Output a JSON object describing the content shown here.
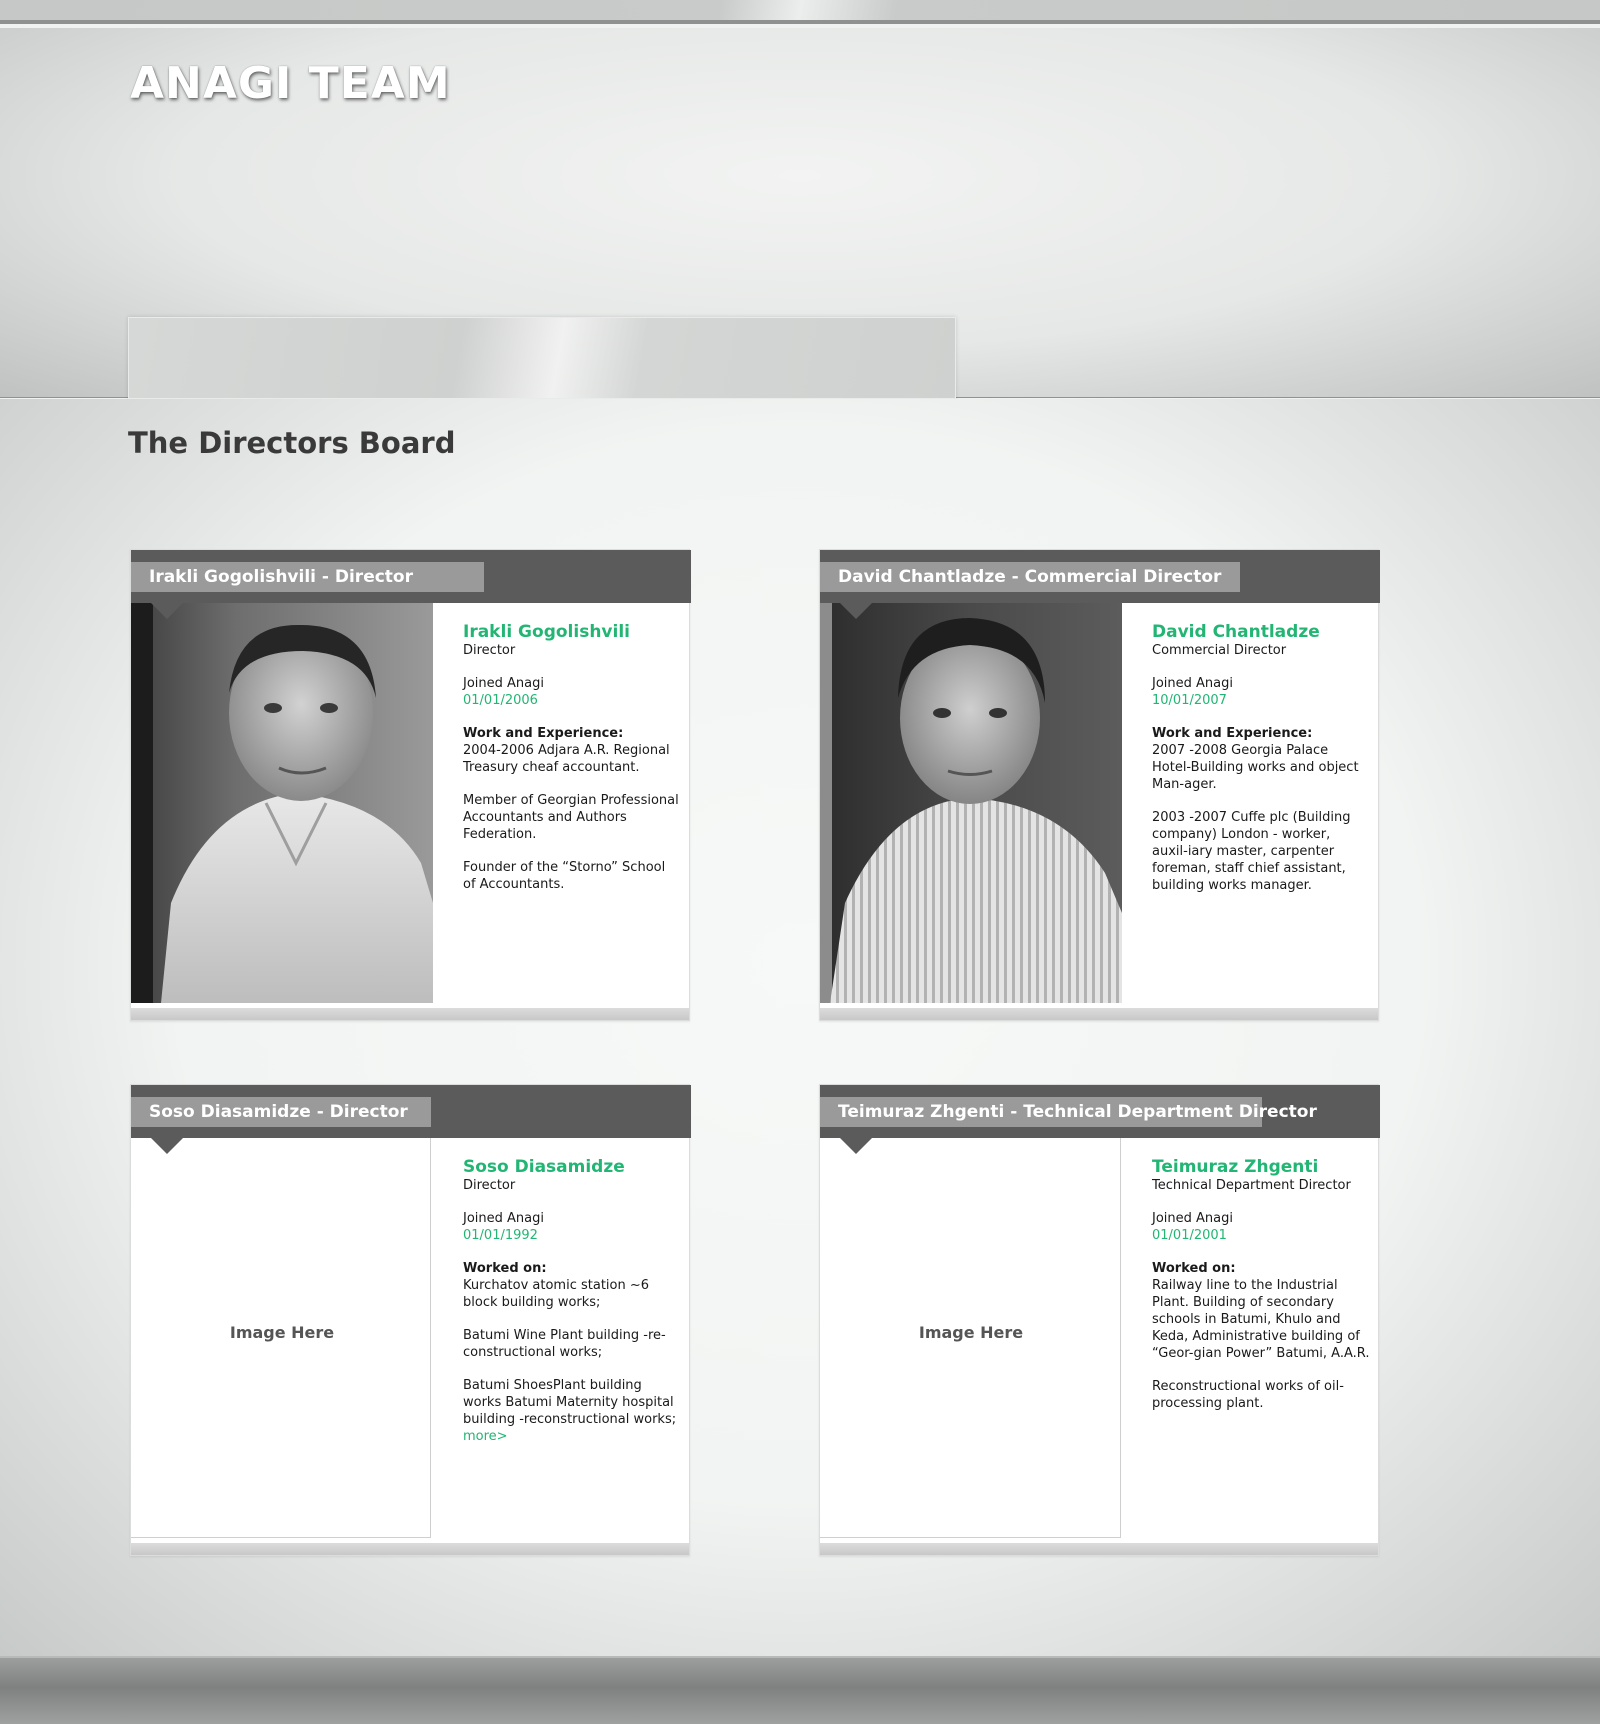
{
  "header": {
    "title": "ANAGI TEAM"
  },
  "section": {
    "title": "The Directors Board"
  },
  "cards": [
    {
      "header_label": "Irakli Gogolishvili - Director",
      "name": "Irakli Gogolishvili",
      "role": "Director",
      "joined_label": "Joined Anagi",
      "joined_date": "01/01/2006",
      "section_heading": "Work and Experience:",
      "paragraphs": [
        "2004-2006 Adjara A.R. Regional Treasury cheaf accountant.",
        "Member of Georgian Professional Accountants and Authors Federation.",
        "Founder of the “Storno” School of Accountants."
      ]
    },
    {
      "header_label": "David Chantladze - Commercial Director",
      "name": "David Chantladze",
      "role": "Commercial Director",
      "joined_label": "Joined Anagi",
      "joined_date": "10/01/2007",
      "section_heading": "Work and Experience:",
      "paragraphs": [
        "2007 -2008 Georgia Palace Hotel-Building works and object Man-ager.",
        "2003 -2007 Cuffe plc (Building company) London - worker, auxil-iary master, carpenter foreman, staff chief assistant, building works manager."
      ]
    },
    {
      "header_label": "Soso Diasamidze - Director",
      "name": "Soso Diasamidze",
      "role": "Director",
      "joined_label": "Joined Anagi",
      "joined_date": "01/01/1992",
      "section_heading": "Worked on:",
      "image_placeholder": "Image Here",
      "paragraphs": [
        "Kurchatov atomic station ~6 block building works;",
        "Batumi Wine Plant building -re-constructional works;",
        "Batumi ShoesPlant building works Batumi Maternity hospital building -reconstructional works;"
      ],
      "more_link": "more>"
    },
    {
      "header_label": "Teimuraz Zhgenti - Technical Department Director",
      "name": "Teimuraz Zhgenti",
      "role": "Technical Department Director",
      "joined_label": "Joined Anagi",
      "joined_date": "01/01/2001",
      "section_heading": "Worked on:",
      "image_placeholder": "Image Here",
      "paragraphs": [
        "Railway line to the Industrial Plant. Building of secondary schools in Batumi, Khulo and Keda, Administrative building of “Geor-gian Power” Batumi, A.A.R.",
        "Reconstructional works of oil-processing plant."
      ]
    }
  ],
  "colors": {
    "accent_green": "#22b573",
    "card_header_dark": "#5b5b5b",
    "card_header_label": "#9a9a9a"
  }
}
